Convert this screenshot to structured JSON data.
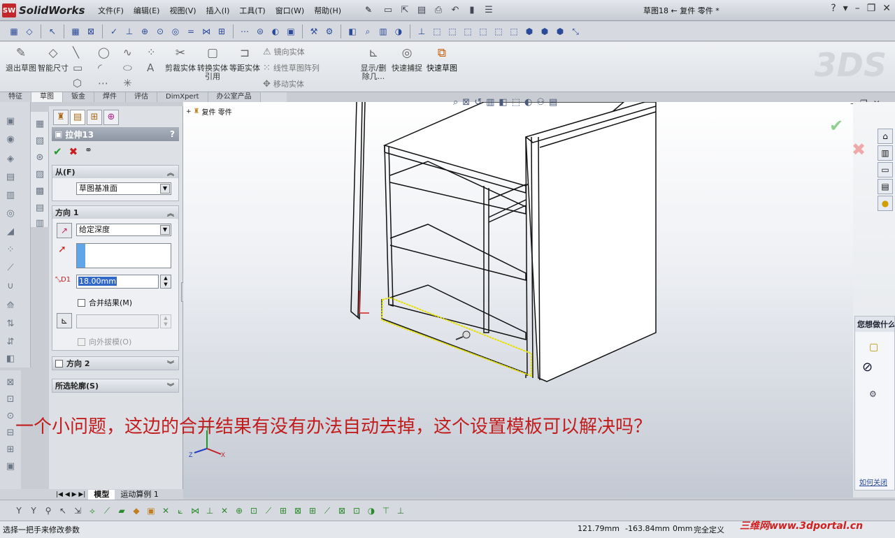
{
  "app": {
    "logo": "SolidWorks",
    "logo_mark": "SW",
    "doc_title": "草图18 ← 复件 零件 *"
  },
  "menu": [
    "文件(F)",
    "编辑(E)",
    "视图(V)",
    "插入(I)",
    "工具(T)",
    "窗口(W)",
    "帮助(H)"
  ],
  "window_controls": [
    "?",
    "▾",
    "–",
    "❐",
    "✕"
  ],
  "command_manager": {
    "exit_sketch": "退出草图",
    "smart_dimension": "智能尺寸",
    "trim": "剪裁实体",
    "convert": "转换实体引用",
    "offset": "等距实体",
    "mirror": "镜向实体",
    "linear_pattern": "线性草图阵列",
    "move": "移动实体",
    "display_delete": "显示/删除几...",
    "quick_snap": "快速捕捉",
    "rapid_sketch": "快速草图"
  },
  "tabs": [
    "特征",
    "草图",
    "钣金",
    "焊件",
    "评估",
    "DimXpert",
    "办公室产品"
  ],
  "active_tab": "草图",
  "property_manager": {
    "title": "拉伸13",
    "help": "?",
    "from": {
      "label": "从(F)",
      "value": "草图基准面"
    },
    "direction1": {
      "label": "方向 1",
      "end_condition": "给定深度",
      "depth": "18.00mm",
      "merge_result": "合并结果(M)",
      "draft_outward": "向外拔模(O)"
    },
    "direction2": {
      "label": "方向 2"
    },
    "selected_contours": {
      "label": "所选轮廓(S)"
    }
  },
  "tree": {
    "root": "复件 零件"
  },
  "hint_panel": {
    "title": "您想做什么",
    "close_link": "如何关闭"
  },
  "model_tabs": [
    "模型",
    "运动算例 1"
  ],
  "active_model_tab": "模型",
  "status": {
    "message": "选择一把手来修改参数",
    "x": "121.79mm",
    "y": "-163.84mm",
    "z": "0mm",
    "state": "完全定义"
  },
  "watermark": "三维网www.3dportal.cn",
  "annotation": "一个小问题，这边的合并结果有没有办法自动去掉，这个设置模板可以解决吗？",
  "triad": {
    "x": "X",
    "y": "Y",
    "z": "Z"
  },
  "colors": {
    "annotation": "#c21d1d",
    "ok": "#1e9a2a",
    "cancel": "#c82020",
    "selection": "#e6e000"
  }
}
